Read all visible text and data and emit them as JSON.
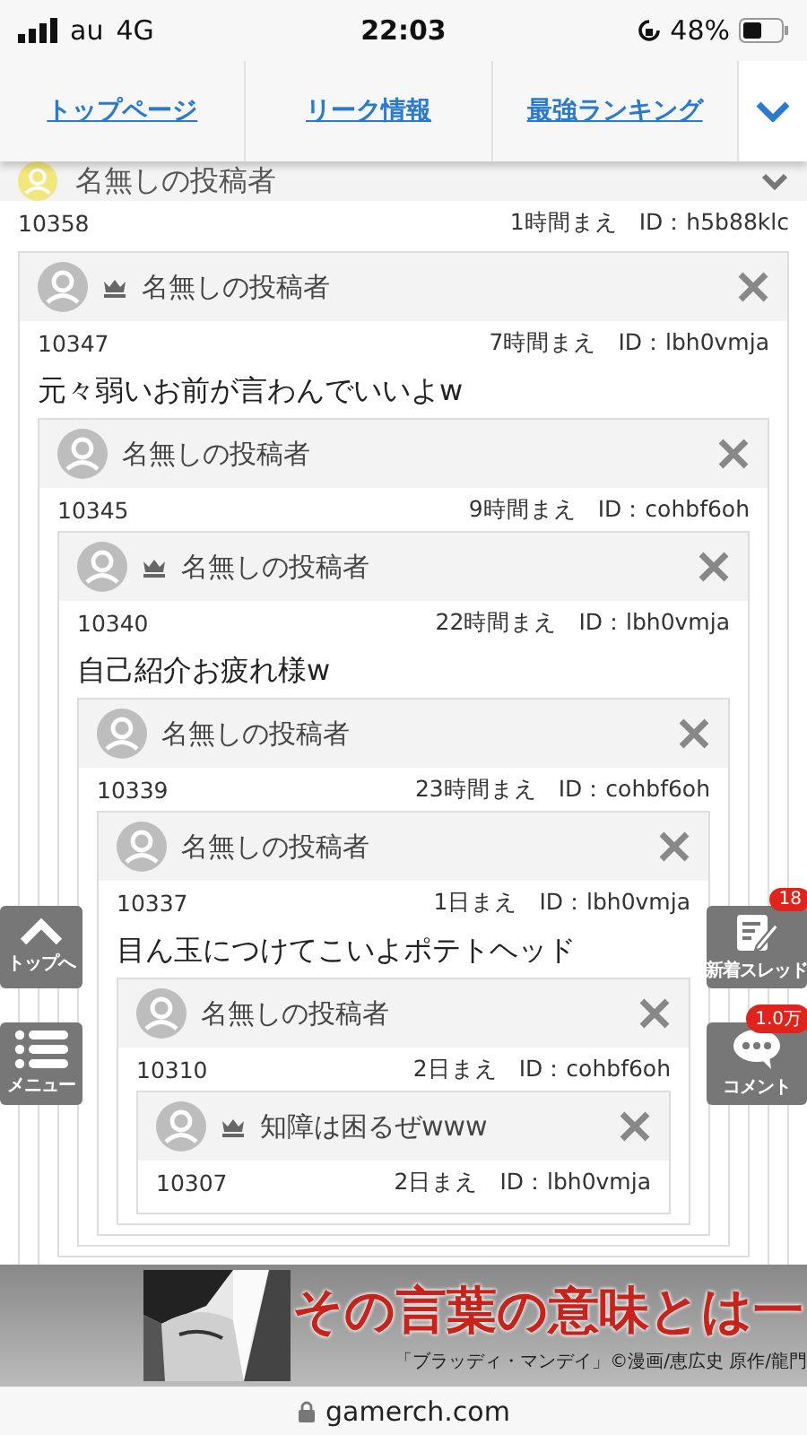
{
  "status_bar": {
    "carrier": "au",
    "network": "4G",
    "time": "22:03",
    "battery": "48%"
  },
  "nav": {
    "tabs": [
      {
        "label": "トップページ"
      },
      {
        "label": "リーク情報"
      },
      {
        "label": "最強ランキング"
      }
    ]
  },
  "thread": {
    "author": "名無しの投稿者",
    "number": "10358",
    "time": "1時間まえ",
    "id": "ID：h5b88klc",
    "replies": [
      {
        "author": "名無しの投稿者",
        "crown": true,
        "number": "10347",
        "time": "7時間まえ",
        "id": "ID：lbh0vmja",
        "body": "元々弱いお前が言わんでいいよw",
        "children": [
          {
            "author": "名無しの投稿者",
            "crown": false,
            "number": "10345",
            "time": "9時間まえ",
            "id": "ID：cohbf6oh",
            "children": [
              {
                "author": "名無しの投稿者",
                "crown": true,
                "number": "10340",
                "time": "22時間まえ",
                "id": "ID：lbh0vmja",
                "body": "自己紹介お疲れ様w",
                "children": [
                  {
                    "author": "名無しの投稿者",
                    "crown": false,
                    "number": "10339",
                    "time": "23時間まえ",
                    "id": "ID：cohbf6oh",
                    "children": [
                      {
                        "author": "名無しの投稿者",
                        "crown": false,
                        "number": "10337",
                        "time": "1日まえ",
                        "id": "ID：lbh0vmja",
                        "body": "目ん玉につけてこいよポテトヘッド",
                        "children": [
                          {
                            "author": "名無しの投稿者",
                            "crown": false,
                            "number": "10310",
                            "time": "2日まえ",
                            "id": "ID：cohbf6oh",
                            "children": [
                              {
                                "author": "知障は困るぜwww",
                                "crown": true,
                                "number": "10307",
                                "time": "2日まえ",
                                "id": "ID：lbh0vmja"
                              }
                            ]
                          }
                        ]
                      }
                    ]
                  }
                ]
              }
            ]
          }
        ]
      }
    ]
  },
  "side_buttons": {
    "left": [
      {
        "kind": "top",
        "label": "トップへ"
      },
      {
        "kind": "menu",
        "label": "メニュー"
      }
    ],
    "right": [
      {
        "kind": "new",
        "label": "新着スレッド",
        "badge": "18"
      },
      {
        "kind": "comment",
        "label": "コメント",
        "badge": "1.0万"
      }
    ]
  },
  "ad": {
    "kind": "picture",
    "headline": "その言葉の意味とは一",
    "caption": "「ブラッディ・マンデイ」©漫画/恵広史 原作/龍門"
  },
  "url_bar": {
    "domain": "gamerch.com"
  }
}
